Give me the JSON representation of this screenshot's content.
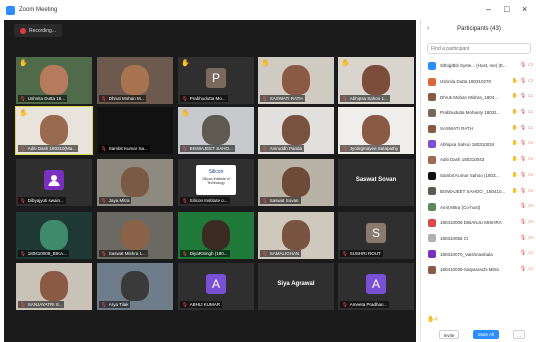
{
  "window": {
    "title": "Zoom Meeting",
    "controls": [
      "–",
      "□",
      "×"
    ]
  },
  "meeting": {
    "recording_label": "Recording..."
  },
  "tiles": [
    {
      "name": "Ushnita Dutta 18...",
      "hand": true,
      "kind": "video",
      "bg": "#4f6b4a",
      "skin": "#b57b5c"
    },
    {
      "name": "Dhruti Mohan M...",
      "hand": false,
      "kind": "video",
      "bg": "#6b5a4d",
      "skin": "#a8734f"
    },
    {
      "name": "Prabhudutta Mo...",
      "hand": true,
      "kind": "avatar",
      "letter": "P",
      "color": "#7a6a5e"
    },
    {
      "name": "SASWATI RATH",
      "hand": true,
      "kind": "video",
      "bg": "#cfcac2",
      "skin": "#8a5a44"
    },
    {
      "name": "Abhipsa Sahoo 1...",
      "hand": true,
      "kind": "video",
      "bg": "#d9d4cc",
      "skin": "#7a4e3a"
    },
    {
      "name": "Aditi Dash 180310(Ma...",
      "hand": true,
      "kind": "video",
      "bg": "#e8e4dc",
      "skin": "#9a6a50",
      "speaking": true
    },
    {
      "name": "Sambit Kumar Sa...",
      "hand": false,
      "kind": "dark",
      "bg": "#111111"
    },
    {
      "name": "BISWAJEET SAHO...",
      "hand": true,
      "kind": "video",
      "bg": "#c7c9cc",
      "skin": "#5e5a52"
    },
    {
      "name": "Aniruddh Panda",
      "hand": false,
      "kind": "video",
      "bg": "#e2e0dc",
      "skin": "#7a5240"
    },
    {
      "name": "Jyotirgmayee Satapathy",
      "hand": false,
      "kind": "video",
      "bg": "#f0eeea",
      "skin": "#8a5a44"
    },
    {
      "name": "Dibyajyoti swain...",
      "hand": false,
      "kind": "person-icon",
      "color": "#7b2fbe"
    },
    {
      "name": "Jaya Mitra",
      "hand": false,
      "kind": "video",
      "bg": "#8f8a80",
      "skin": "#7a5a44"
    },
    {
      "name": "Silicon Institute o...",
      "hand": false,
      "kind": "logo",
      "logo_text": "Silicon",
      "logo_sub": "Silicon Institute of Technology"
    },
    {
      "name": "Saswat Sovan",
      "hand": false,
      "kind": "video",
      "bg": "#b9b2a6",
      "skin": "#6e4a38"
    },
    {
      "name": "Saswat Sovan",
      "hand": false,
      "kind": "text",
      "center": "Saswat Sovan"
    },
    {
      "name": "180410009_BIKA...",
      "hand": false,
      "kind": "video",
      "bg": "#1f3a35",
      "skin": "#3e8a6a"
    },
    {
      "name": "Saswat Mishra 1...",
      "hand": false,
      "kind": "video",
      "bg": "#6a6a62",
      "skin": "#8a6248"
    },
    {
      "name": "DiyaRSingh (180...",
      "hand": false,
      "kind": "video",
      "bg": "#1f7a3a",
      "skin": "#3b2a22"
    },
    {
      "name": "SAMALIGHAN",
      "hand": false,
      "kind": "video",
      "bg": "#cfc8bd",
      "skin": "#7a5442"
    },
    {
      "name": "SUSHRI ROUT",
      "hand": false,
      "kind": "avatar",
      "letter": "S",
      "color": "#8a7a6e"
    },
    {
      "name": "SANJAYATRI S...",
      "hand": false,
      "kind": "video",
      "bg": "#c9c2b6",
      "skin": "#8a5a44"
    },
    {
      "name": "Arya Tilak",
      "hand": false,
      "kind": "video",
      "bg": "#6f7d8a",
      "skin": "#3a3a3a"
    },
    {
      "name": "ABHIJ KUMAR",
      "hand": false,
      "kind": "avatar",
      "letter": "A",
      "color": "#7b4fd6"
    },
    {
      "name": "Siya Agrawal",
      "hand": false,
      "kind": "text",
      "center": "Siya Agrawal"
    },
    {
      "name": "Ameeta Pradhan...",
      "hand": false,
      "kind": "avatar",
      "letter": "A",
      "color": "#7b4fd6"
    }
  ],
  "participants": {
    "title": "Participants (43)",
    "collapse_icon": "chevron-left",
    "search_placeholder": "Find a participant",
    "items": [
      {
        "name": "Sitbig/Biti Syste... (Host, me)  (E...",
        "av_color": "#2d8cff",
        "hand": false
      },
      {
        "name": "Ushnita Dutta 180310270",
        "av_color": "#d86a3a",
        "hand": true
      },
      {
        "name": "Dhruti Mohan Mishra_1804...",
        "av_color": "#8a5a44",
        "hand": true
      },
      {
        "name": "Prabhudutta Mohanty 18031...",
        "av_color": "#7a6a5e",
        "hand": true
      },
      {
        "name": "SASWATI RATH",
        "av_color": "#8a5a44",
        "hand": true
      },
      {
        "name": "Abhipsa Sahoo 180310034",
        "av_color": "#7b4fd6",
        "hand": true
      },
      {
        "name": "Aditi Dash 180310043",
        "av_color": "#9a6a50",
        "hand": true
      },
      {
        "name": "Sambit Kumar Sahoo (1803...",
        "av_color": "#111111",
        "hand": true
      },
      {
        "name": "BISWAJEET SAHOO _180410...",
        "av_color": "#5e5a52",
        "hand": true
      },
      {
        "name": "Amit Mitra (Co-host)",
        "av_color": "#5a8a5a",
        "hand": false
      },
      {
        "name": "180410006 DIBANJU MISHRA",
        "av_color": "#d84a4a",
        "hand": false
      },
      {
        "name": "180310055 CI",
        "av_color": "#b0b0b0",
        "hand": false
      },
      {
        "name": "180310070_Vaishnavibala",
        "av_color": "#7b2fbe",
        "hand": false
      },
      {
        "name": "180410035-Satyasrachi Mitra",
        "av_color": "#8a5a44",
        "hand": false
      }
    ],
    "reaction_count": "4",
    "invite_label": "Invite",
    "mute_all_label": "Mute All",
    "more_label": "..."
  }
}
